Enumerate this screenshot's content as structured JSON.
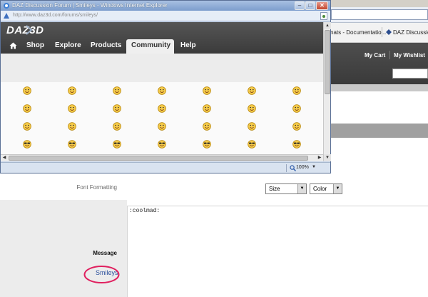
{
  "popup": {
    "title": "DAZ Discussion Forum | Smileys - Windows Internet Explorer",
    "url": "http://www.daz3d.com/forums/smileys/",
    "site": {
      "logo": "DAZ3D",
      "nav": [
        {
          "label": "Shop"
        },
        {
          "label": "Explore"
        },
        {
          "label": "Products"
        },
        {
          "label": "Community",
          "active": true
        },
        {
          "label": "Help"
        }
      ]
    },
    "zoom": "100%"
  },
  "background_page": {
    "favorites": [
      "nats - Documentatio...",
      "DAZ Discussion"
    ],
    "header_links": [
      "My Cart",
      "My Wishlist"
    ],
    "form": {
      "font_formatting_label": "Font Formatting",
      "size_select": "Size",
      "color_select": "Color",
      "message_label": "Message",
      "message_value": ":coolmad:",
      "smileys_link": "Smileys"
    }
  },
  "colors": {
    "nav_dark": "#444444",
    "link_blue": "#2a4f9c",
    "highlight_circle": "#e0205f",
    "smiley_yellow": "#f6cc4a"
  }
}
